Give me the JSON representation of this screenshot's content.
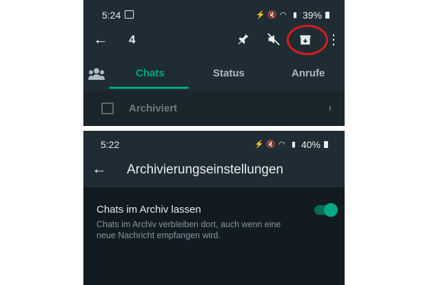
{
  "top_screen": {
    "status": {
      "time": "5:24",
      "battery": "39%"
    },
    "appbar": {
      "count": "4"
    },
    "tabs": [
      {
        "label": "Chats",
        "active": true
      },
      {
        "label": "Status",
        "active": false
      },
      {
        "label": "Anrufe",
        "active": false
      }
    ],
    "archived_row": {
      "label": "Archiviert"
    },
    "highlight_color": "#d91c1c"
  },
  "bottom_screen": {
    "status": {
      "time": "5:22",
      "battery": "40%"
    },
    "title": "Archivierungseinstellungen",
    "setting": {
      "title": "Chats im Archiv lassen",
      "description": "Chats im Archiv verbleiben dort, auch wenn eine neue Nachricht empfangen wird.",
      "enabled": true
    }
  },
  "colors": {
    "accent": "#00a884",
    "top_bg": "#1f2c34",
    "bottom_bg": "#111b21"
  }
}
